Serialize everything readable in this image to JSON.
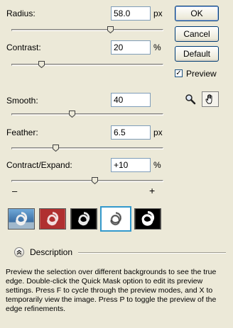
{
  "fields": {
    "radius": {
      "label": "Radius:",
      "value": "58.0",
      "unit": "px",
      "slider_level": 0.65
    },
    "contrast": {
      "label": "Contrast:",
      "value": "20",
      "unit": "%",
      "slider_level": 0.2
    },
    "smooth": {
      "label": "Smooth:",
      "value": "40",
      "unit": "",
      "slider_level": 0.4
    },
    "feather": {
      "label": "Feather:",
      "value": "6.5",
      "unit": "px",
      "slider_level": 0.29
    },
    "contract_expand": {
      "label": "Contract/Expand:",
      "value": "+10",
      "unit": "%",
      "slider_level": 0.55
    }
  },
  "contract_expand_scale": {
    "minus": "–",
    "plus": "+"
  },
  "buttons": {
    "ok": "OK",
    "cancel": "Cancel",
    "default": "Default"
  },
  "preview": {
    "label": "Preview",
    "checked": true
  },
  "tools": [
    "zoom-icon",
    "hand-icon"
  ],
  "preview_modes": [
    {
      "name": "standard",
      "bg": "#2f6aa8"
    },
    {
      "name": "quick-mask",
      "bg": "#b03030"
    },
    {
      "name": "on-black",
      "bg": "#000000"
    },
    {
      "name": "on-white",
      "bg": "#ffffff",
      "selected": true
    },
    {
      "name": "mask",
      "bg": "#000000"
    }
  ],
  "description": {
    "title": "Description",
    "text": "Preview the selection over different backgrounds to see the true edge. Double-click the Quick Mask option to edit its preview settings. Press F to cycle through the preview modes, and X to temporarily view the image. Press P to toggle the preview of the edge refinements."
  },
  "colors": {
    "accent": "#3399cc",
    "dialog_bg": "#ece9d8"
  }
}
